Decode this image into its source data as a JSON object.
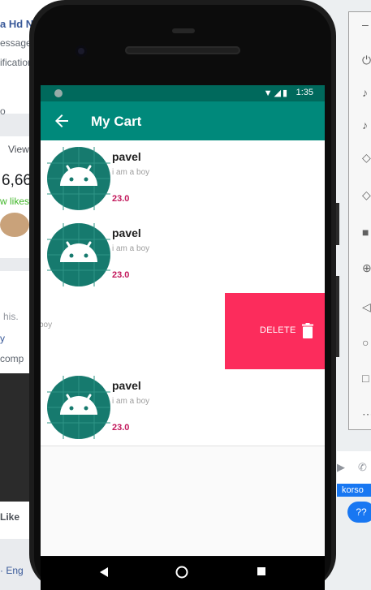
{
  "background": {
    "fb_lines": [
      "a Hd N",
      "essage",
      "ification",
      "o",
      "View",
      "6,66",
      "w likes",
      "his.",
      "y",
      "comp",
      "Like",
      "· Eng"
    ],
    "fb_chat_label": "korso",
    "fb_bubble": "??"
  },
  "status_bar": {
    "time": "1:35"
  },
  "app_bar": {
    "title": "My Cart"
  },
  "cart_items": [
    {
      "name": "pavel",
      "description": "i am a boy",
      "price": "23.0"
    },
    {
      "name": "pavel",
      "description": "i am a boy",
      "price": "23.0"
    },
    {
      "name": "pavel",
      "description": "i am a boy",
      "price": "23.0"
    }
  ],
  "swiped_item": {
    "visible_text": "boy",
    "action_label": "DELETE"
  },
  "colors": {
    "status_bar": "#00695c",
    "app_bar": "#00897b",
    "price": "#c2185b",
    "delete_background": "#fc2c5c",
    "avatar_background": "#167a6e"
  }
}
